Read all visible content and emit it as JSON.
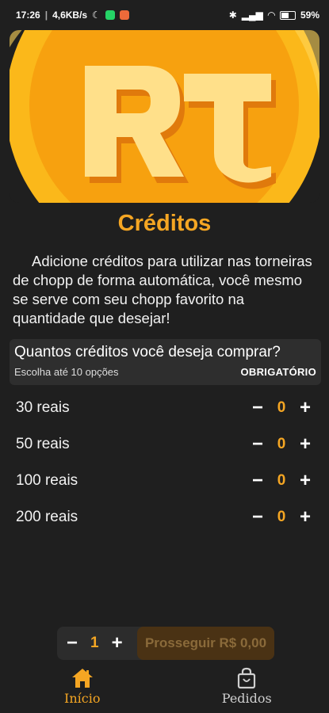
{
  "status_bar": {
    "time": "17:26",
    "speed": "4,6KB/s",
    "battery": "59%"
  },
  "colors": {
    "accent": "#f5a623",
    "background": "#1f1f1f",
    "panel": "#2e2e2e"
  },
  "page": {
    "title": "Créditos",
    "description": "Adicione créditos para utilizar nas torneiras de chopp de forma automática, você mesmo se serve com seu chopp favorito na quantidade que desejar!"
  },
  "question": {
    "title": "Quantos créditos você deseja comprar?",
    "subtitle": "Escolha até 10 opções",
    "required_label": "OBRIGATÓRIO"
  },
  "options": [
    {
      "label": "30 reais",
      "qty": "0"
    },
    {
      "label": "50 reais",
      "qty": "0"
    },
    {
      "label": "100 reais",
      "qty": "0"
    },
    {
      "label": "200 reais",
      "qty": "0"
    }
  ],
  "cart": {
    "minus": "−",
    "plus": "+",
    "qty": "1",
    "proceed_label": "Prosseguir R$ 0,00"
  },
  "nav": {
    "home_label": "Início",
    "orders_label": "Pedidos"
  },
  "stepper": {
    "minus": "−",
    "plus": "+"
  }
}
